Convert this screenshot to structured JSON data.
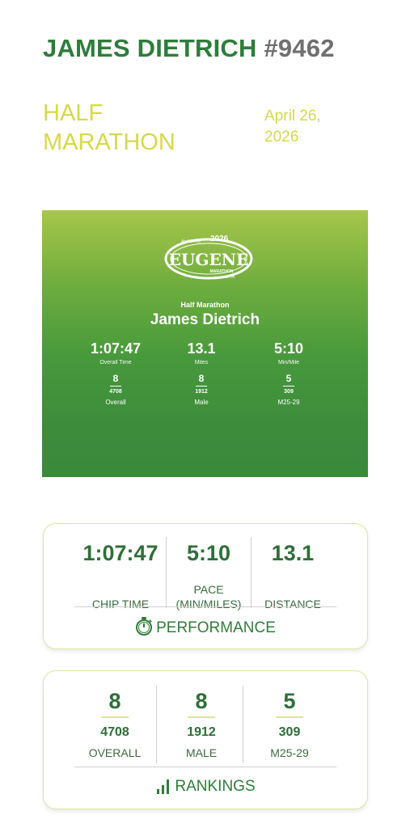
{
  "header": {
    "name": "JAMES DIETRICH",
    "bib": "#9462"
  },
  "event": {
    "title_line1": "HALF",
    "title_line2": "MARATHON",
    "date_line1": "April 26,",
    "date_line2": "2026"
  },
  "certificate": {
    "logo_text": "EUGENE",
    "logo_year": "2026",
    "logo_dates": "April 24-26",
    "logo_sub": "MARATHON",
    "logo_place": "EUGENE, OR",
    "event_name": "Half Marathon",
    "runner_name": "James Dietrich",
    "stats": [
      {
        "value": "1:07:47",
        "label": "Overall Time"
      },
      {
        "value": "13.1",
        "label": "Miles"
      },
      {
        "value": "5:10",
        "label": "Min/Mile"
      }
    ],
    "ranks": [
      {
        "place": "8",
        "of": "4708",
        "label": "Overall"
      },
      {
        "place": "8",
        "of": "1912",
        "label": "Male"
      },
      {
        "place": "5",
        "of": "309",
        "label": "M25-29"
      }
    ]
  },
  "performance": {
    "chip_time": {
      "value": "1:07:47",
      "label": "CHIP TIME"
    },
    "pace": {
      "value": "5:10",
      "label_line1": "PACE",
      "label_line2": "(MIN/MILES)"
    },
    "distance": {
      "value": "13.1",
      "label": "DISTANCE"
    },
    "footer": "PERFORMANCE",
    "icon": "stopwatch-icon"
  },
  "rankings": {
    "overall": {
      "place": "8",
      "of": "4708",
      "label": "OVERALL"
    },
    "male": {
      "place": "8",
      "of": "1912",
      "label": "MALE"
    },
    "age": {
      "place": "5",
      "of": "309",
      "label": "M25-29"
    },
    "footer": "RANKINGS",
    "icon": "bar-chart-icon"
  },
  "colors": {
    "brand_green": "#2e7d3a",
    "accent_yellow": "#d6d94a",
    "bib_gray": "#6f6f6f"
  }
}
